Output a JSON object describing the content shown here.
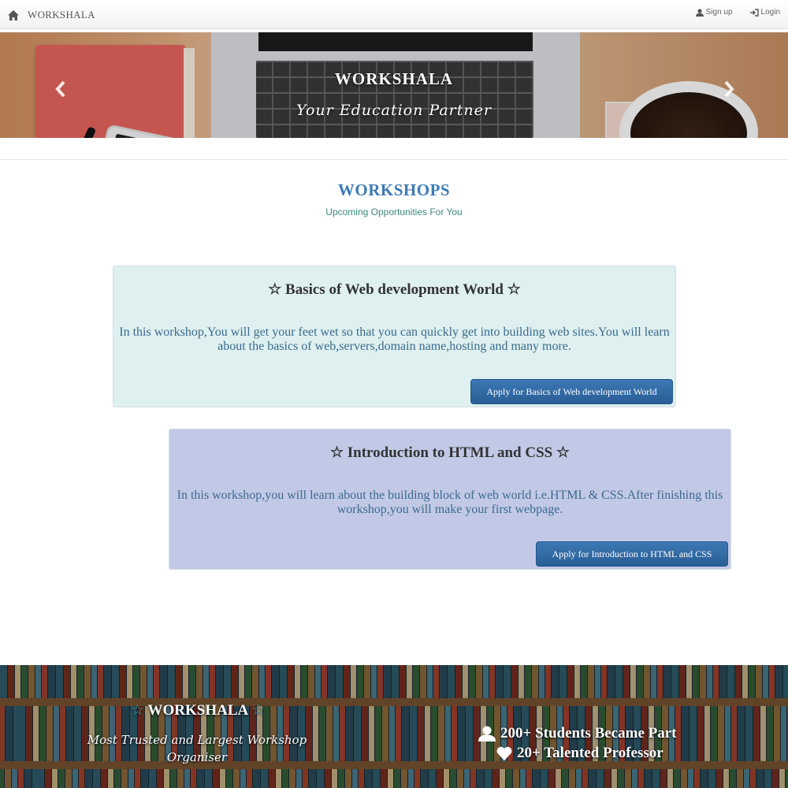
{
  "navbar": {
    "brand": "WORKSHALA",
    "home_icon": "home-icon",
    "signup_label": "Sign up",
    "signup_icon": "user-icon",
    "login_label": "Login",
    "login_icon": "login-icon"
  },
  "carousel": {
    "title": "WORKSHALA",
    "subtitle": "Your Education Partner",
    "prev_icon": "chevron-left-icon",
    "next_icon": "chevron-right-icon"
  },
  "section": {
    "title": "WORKSHOPS",
    "subtitle": "Upcoming Opportunities For You"
  },
  "workshops": [
    {
      "title": "☆ Basics of Web development World ☆",
      "description": "In this workshop,You will get your feet wet so that you can quickly get into building web sites.You will learn about the basics of web,servers,domain name,hosting and many more.",
      "button": "Apply for Basics of Web development World",
      "background": "#def0ef"
    },
    {
      "title": "☆ Introduction to HTML and CSS ☆",
      "description": "In this workshop,you will learn about the building block of web world i.e.HTML & CSS.After finishing this workshop,you will make your first webpage.",
      "button": "Apply for Introduction to HTML and CSS",
      "background": "#c2c9e6"
    }
  ],
  "footer": {
    "star": "☆",
    "title": "WORKSHALA",
    "tagline": "Most Trusted and Largest Workshop Organiser",
    "stats": [
      {
        "icon": "user-icon",
        "text": "200+ Students Became Part"
      },
      {
        "icon": "heart-icon",
        "text": "20+ Talented Professor"
      }
    ]
  },
  "colors": {
    "accent": "#3d7ab5",
    "button": "#2f6aa5",
    "subtitle": "#3a8a80"
  }
}
